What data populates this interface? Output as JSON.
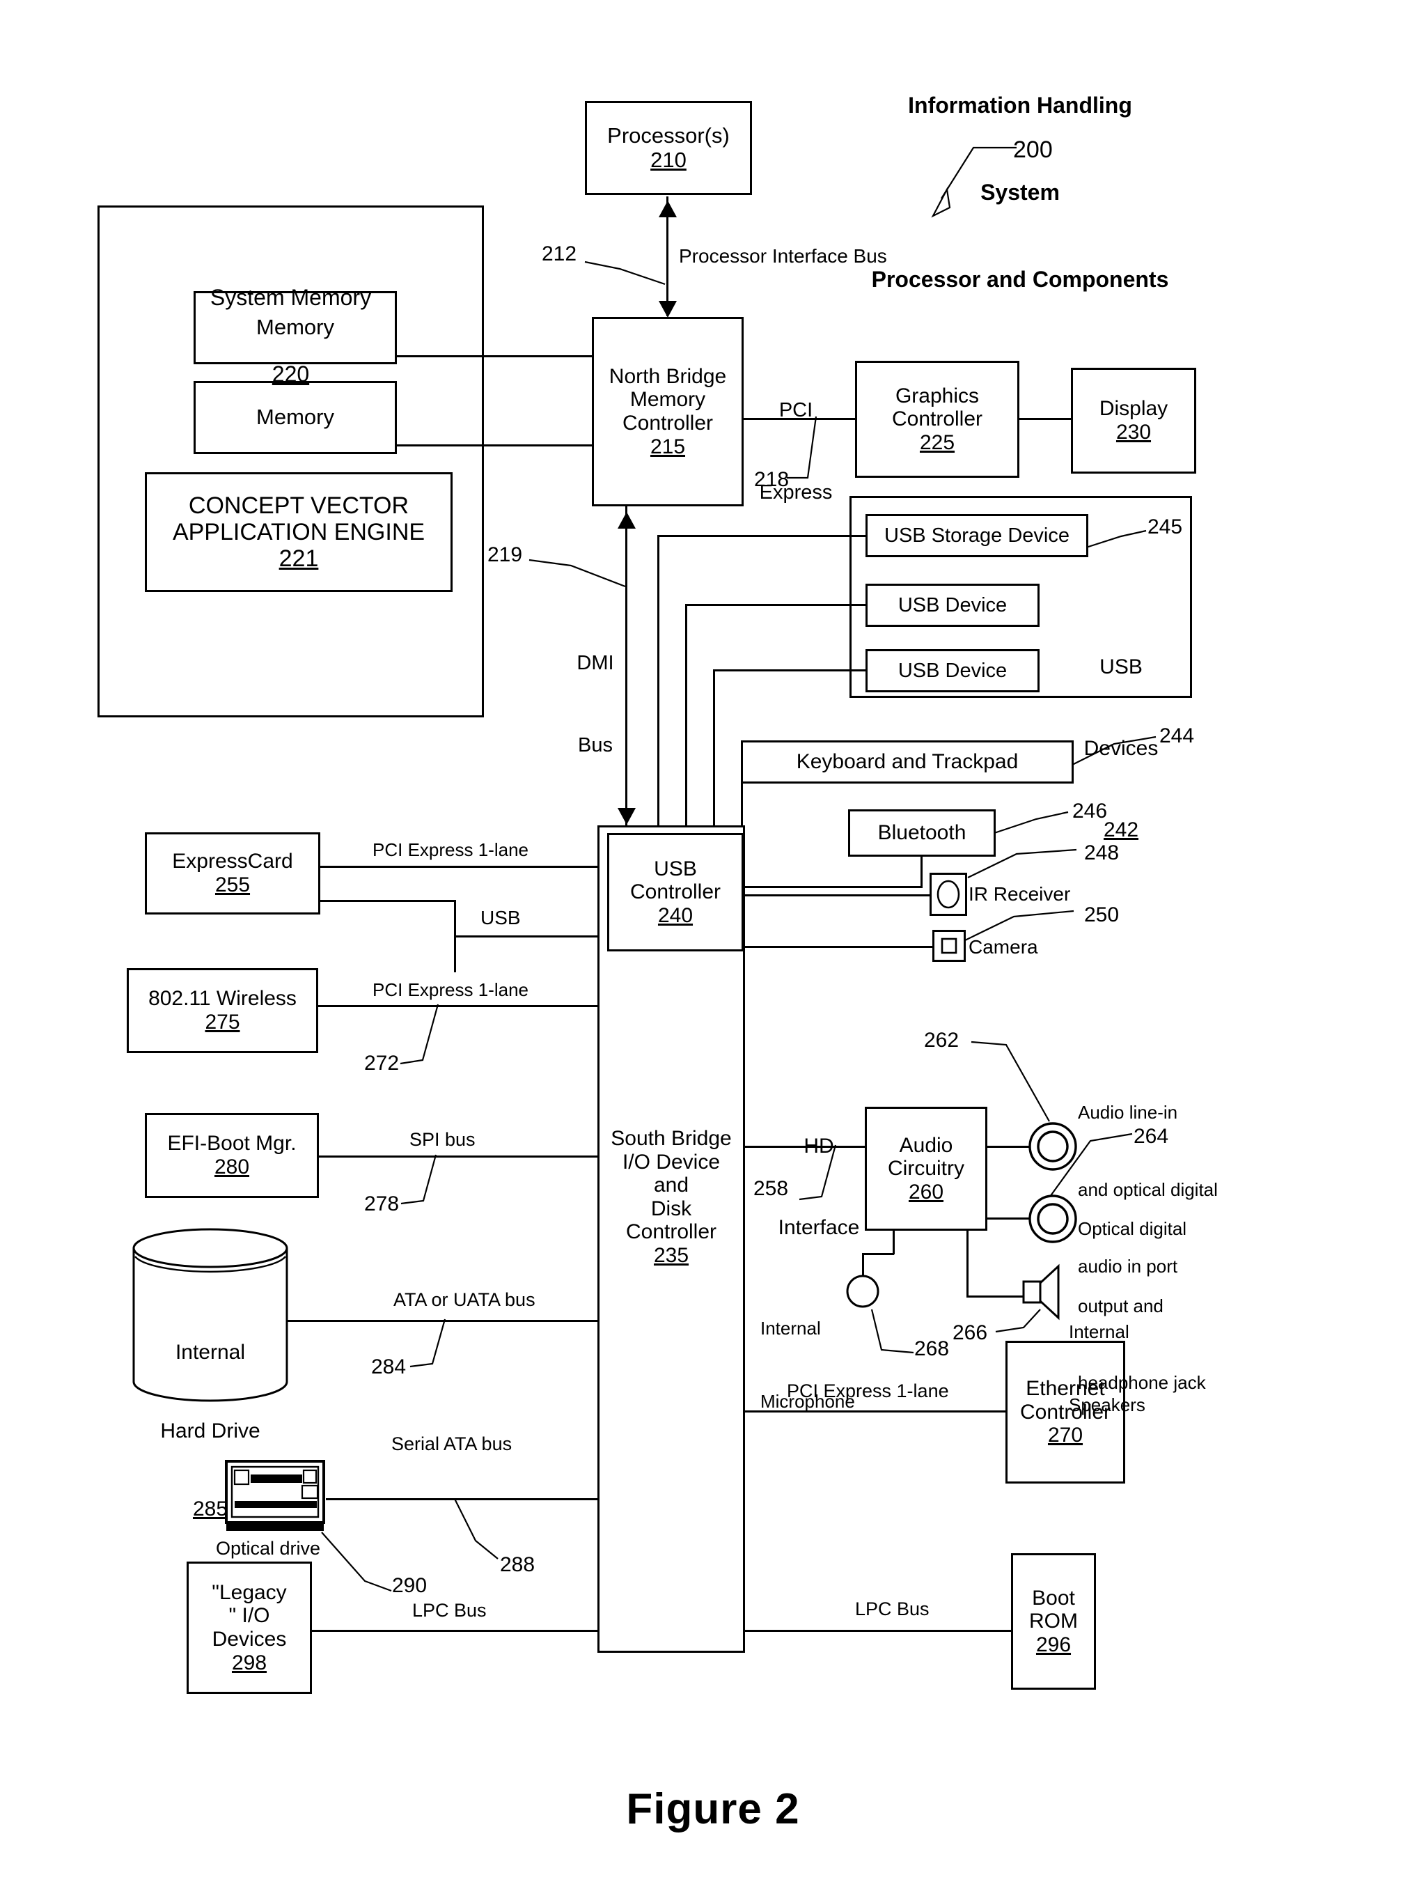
{
  "figure": {
    "caption": "Figure 2",
    "title_line1": "Information Handling",
    "title_line2": "System",
    "title_line3": "Processor and Components",
    "title_ref": "200"
  },
  "blocks": {
    "processor": {
      "label": "Processor(s)",
      "num": "210"
    },
    "system_memory": {
      "label": "System Memory",
      "num": "220"
    },
    "memory_1": {
      "label": "Memory"
    },
    "memory_2": {
      "label": "Memory"
    },
    "concept_engine": {
      "label_line1": "CONCEPT VECTOR",
      "label_line2": "APPLICATION ENGINE",
      "num": "221"
    },
    "north_bridge": {
      "line1": "North Bridge",
      "line2": "Memory",
      "line3": "Controller",
      "num": "215"
    },
    "graphics": {
      "line1": "Graphics",
      "line2": "Controller",
      "num": "225"
    },
    "display": {
      "label": "Display",
      "num": "230"
    },
    "usb_storage": {
      "label": "USB Storage Device"
    },
    "usb_device_1": {
      "label": "USB Device"
    },
    "usb_device_2": {
      "label": "USB Device"
    },
    "usb_devices_group": {
      "line1": "USB",
      "line2": "Devices",
      "num": "242"
    },
    "keyboard": {
      "label": "Keyboard and Trackpad"
    },
    "bluetooth": {
      "label": "Bluetooth"
    },
    "ir_receiver": {
      "label": "IR Receiver"
    },
    "camera": {
      "label": "Camera"
    },
    "usb_controller": {
      "line1": "USB",
      "line2": "Controller",
      "num": "240"
    },
    "south_bridge": {
      "line1": "South Bridge",
      "line2": "I/O Device",
      "line3": "and",
      "line4": "Disk",
      "line5": "Controller",
      "num": "235"
    },
    "expresscard": {
      "label": "ExpressCard",
      "num": "255"
    },
    "wireless": {
      "label": "802.11 Wireless",
      "num": "275"
    },
    "efi_boot": {
      "label": "EFI-Boot Mgr.",
      "num": "280"
    },
    "hard_drive": {
      "line1": "Internal",
      "line2": "Hard Drive",
      "num": "285"
    },
    "optical_drive": {
      "label": "Optical drive"
    },
    "legacy_io": {
      "line1": "\"Legacy",
      "line2": "\" I/O",
      "line3": "Devices",
      "num": "298"
    },
    "audio": {
      "line1": "Audio",
      "line2": "Circuitry",
      "num": "260"
    },
    "audio_in_port": {
      "line1": "Audio line-in",
      "line2": "and optical digital",
      "line3": "audio in port"
    },
    "audio_out_port": {
      "line1": "Optical digital",
      "line2": "output and",
      "line3": "headphone jack"
    },
    "internal_mic": {
      "line1": "Internal",
      "line2": "Microphone"
    },
    "internal_speakers": {
      "line1": "Internal",
      "line2": "Speakers"
    },
    "ethernet": {
      "line1": "Ethernet",
      "line2": "Controller",
      "num": "270"
    },
    "boot_rom": {
      "line1": "Boot",
      "line2": "ROM",
      "num": "296"
    }
  },
  "buses": {
    "processor_interface": "Processor Interface Bus",
    "pci_express_line1": "PCI",
    "pci_express_line2": "Express",
    "dmi_line1": "DMI",
    "dmi_line2": "Bus",
    "pcie_1lane_expresscard": "PCI Express 1-lane",
    "usb_bus": "USB",
    "pcie_1lane_wireless": "PCI Express 1-lane",
    "spi_bus": "SPI bus",
    "ata_bus": "ATA or UATA bus",
    "serial_ata_bus": "Serial ATA bus",
    "lpc_bus_left": "LPC Bus",
    "lpc_bus_right": "LPC Bus",
    "pcie_1lane_ethernet": "PCI Express 1-lane",
    "hd_interface_line1": "HD",
    "hd_interface_line2": "Interface"
  },
  "refs": {
    "r212": "212",
    "r218": "218",
    "r219": "219",
    "r244": "244",
    "r245": "245",
    "r246": "246",
    "r248": "248",
    "r250": "250",
    "r258": "258",
    "r262": "262",
    "r264": "264",
    "r266": "266",
    "r268": "268",
    "r272": "272",
    "r278": "278",
    "r284": "284",
    "r288": "288",
    "r290": "290"
  },
  "colors": {
    "ink": "#000000",
    "paper": "#ffffff"
  }
}
